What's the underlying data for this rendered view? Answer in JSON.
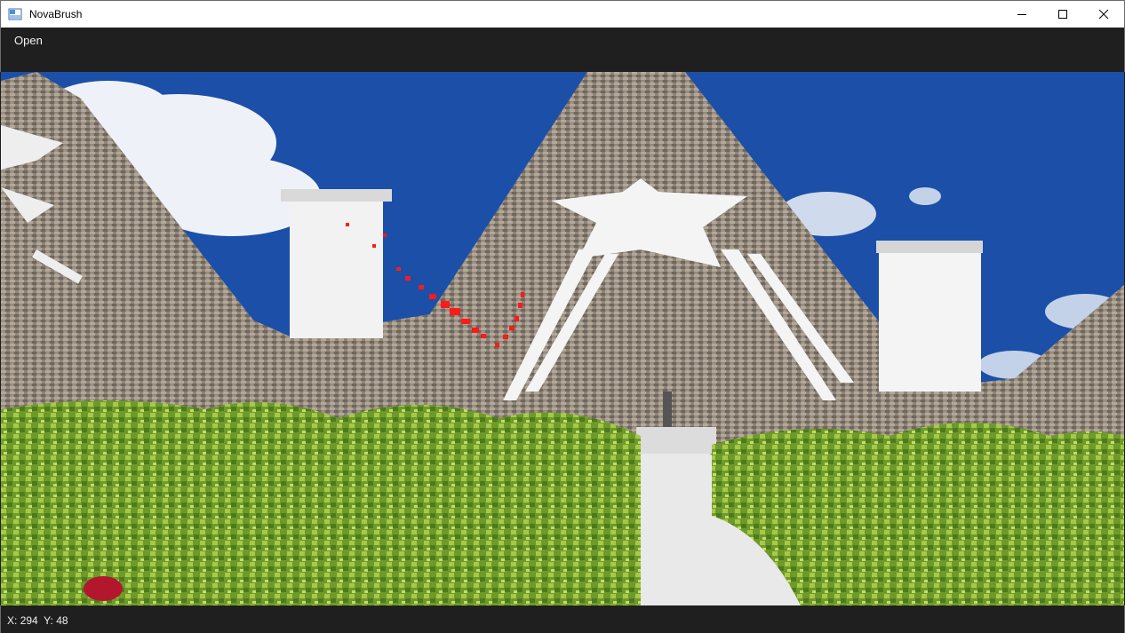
{
  "window": {
    "title": "NovaBrush"
  },
  "menu": {
    "open_label": "Open"
  },
  "status": {
    "x_label": "X:",
    "x_value": "294",
    "y_label": "Y:",
    "y_value": "48"
  },
  "canvas": {
    "image": "photo-trulli-rooftops",
    "brush_color": "#ff0000",
    "sky_color": "#1c4fa8"
  }
}
